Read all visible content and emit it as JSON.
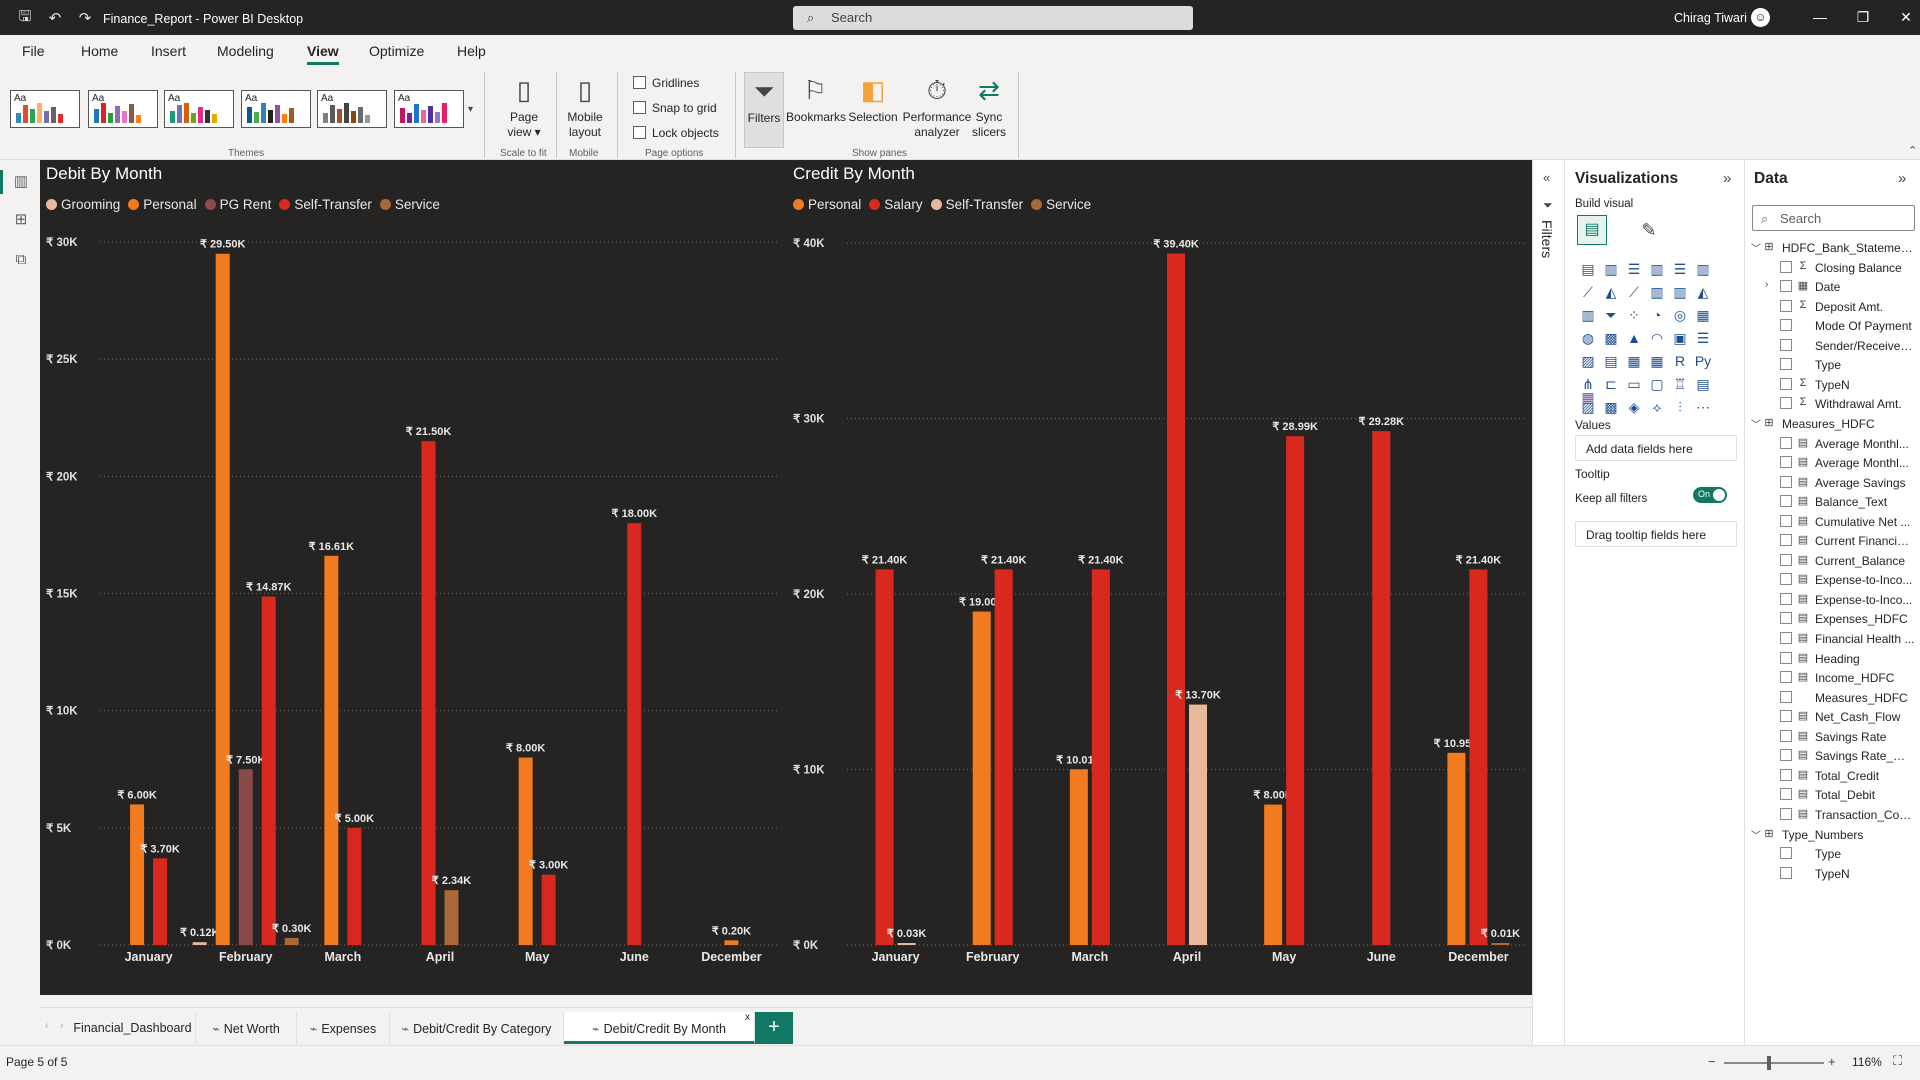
{
  "app": {
    "title": "Finance_Report - Power BI Desktop",
    "search_placeholder": "Search",
    "user_name": "Chirag Tiwari"
  },
  "menu": [
    "File",
    "Home",
    "Insert",
    "Modeling",
    "View",
    "Optimize",
    "Help"
  ],
  "ribbon": {
    "themes_label": "Themes",
    "page_view": "Page view",
    "scale_to_fit": "Scale to fit",
    "mobile_layout": "Mobile layout",
    "mobile": "Mobile",
    "gridlines": "Gridlines",
    "snap_to_grid": "Snap to grid",
    "lock_objects": "Lock objects",
    "page_options": "Page options",
    "filters": "Filters",
    "bookmarks": "Bookmarks",
    "selection": "Selection",
    "performance_analyzer": "Performance analyzer",
    "sync_slicers": "Sync slicers",
    "show_panes": "Show panes"
  },
  "colors": {
    "Grooming": "#e8b89a",
    "Personal": "#f27a1f",
    "PG Rent": "#8a4a4a",
    "Self-Transfer": "#d9291f",
    "Service": "#a8683a",
    "Salary": "#d9291f",
    "Self-Transfer-Credit": "#e8b89a",
    "Service-Credit": "#a8683a",
    "accent": "#117865"
  },
  "chart_data": [
    {
      "type": "bar",
      "title": "Debit By Month",
      "categories": [
        "January",
        "February",
        "March",
        "April",
        "May",
        "June",
        "December"
      ],
      "ylim": [
        0,
        30000
      ],
      "yticks": [
        "₹ 0K",
        "₹ 5K",
        "₹ 10K",
        "₹ 15K",
        "₹ 20K",
        "₹ 25K",
        "₹ 30K"
      ],
      "legend": "top-left",
      "series": [
        {
          "name": "Grooming",
          "values": [
            null,
            120,
            null,
            null,
            null,
            null,
            null
          ],
          "labels": [
            "",
            "₹ 0.12K",
            "",
            "",
            "",
            "",
            ""
          ]
        },
        {
          "name": "Personal",
          "values": [
            6000,
            29500,
            16610,
            null,
            8000,
            null,
            200
          ],
          "labels": [
            "₹ 6.00K",
            "₹ 29.50K",
            "₹ 16.61K",
            "",
            "₹ 8.00K",
            "",
            "₹ 0.20K"
          ]
        },
        {
          "name": "PG Rent",
          "values": [
            null,
            7500,
            null,
            null,
            null,
            null,
            null
          ],
          "labels": [
            "",
            "₹ 7.50K",
            "",
            "",
            "",
            "",
            ""
          ]
        },
        {
          "name": "Self-Transfer",
          "values": [
            3700,
            14870,
            5000,
            21500,
            3000,
            18000,
            null
          ],
          "labels": [
            "₹ 3.70K",
            "₹ 14.87K",
            "₹ 5.00K",
            "₹ 21.50K",
            "₹ 3.00K",
            "₹ 18.00K",
            ""
          ]
        },
        {
          "name": "Service",
          "values": [
            null,
            300,
            null,
            2340,
            null,
            null,
            null
          ],
          "labels": [
            "",
            "₹ 0.30K",
            "",
            "₹ 2.34K",
            "",
            "",
            ""
          ]
        }
      ]
    },
    {
      "type": "bar",
      "title": "Credit By Month",
      "categories": [
        "January",
        "February",
        "March",
        "April",
        "May",
        "June",
        "December"
      ],
      "ylim": [
        0,
        40000
      ],
      "yticks": [
        "₹ 0K",
        "₹ 10K",
        "₹ 20K",
        "₹ 30K",
        "₹ 40K"
      ],
      "legend": "top-left",
      "series": [
        {
          "name": "Personal",
          "values": [
            null,
            19000,
            10010,
            null,
            8000,
            null,
            10950
          ],
          "labels": [
            "",
            "₹ 19.00K",
            "₹ 10.01K",
            "",
            "₹ 8.00K",
            "",
            "₹ 10.95K"
          ]
        },
        {
          "name": "Salary",
          "values": [
            21400,
            21400,
            21400,
            39400,
            28990,
            29280,
            21400
          ],
          "labels": [
            "₹ 21.40K",
            "₹ 21.40K",
            "₹ 21.40K",
            "₹ 39.40K",
            "₹ 28.99K",
            "₹ 29.28K",
            "₹ 21.40K"
          ]
        },
        {
          "name": "Self-Transfer",
          "values": [
            30,
            null,
            null,
            13700,
            null,
            null,
            null
          ],
          "labels": [
            "₹ 0.03K",
            "",
            "",
            "₹ 13.70K",
            "",
            "",
            ""
          ]
        },
        {
          "name": "Service",
          "values": [
            null,
            null,
            null,
            null,
            null,
            null,
            10
          ],
          "labels": [
            "",
            "",
            "",
            "",
            "",
            "",
            "₹ 0.01K"
          ]
        }
      ]
    }
  ],
  "filters_pane": {
    "label": "Filters"
  },
  "viz_pane": {
    "title": "Visualizations",
    "build_visual": "Build visual",
    "values": "Values",
    "values_placeholder": "Add data fields here",
    "tooltip": "Tooltip",
    "keep_all_filters": "Keep all filters",
    "toggle_state": "On",
    "tooltip_placeholder": "Drag tooltip fields here"
  },
  "data_pane": {
    "title": "Data",
    "search_placeholder": "Search",
    "items": [
      {
        "kind": "table",
        "text": "HDFC_Bank_Statement ..."
      },
      {
        "kind": "field",
        "icon": "Σ",
        "text": "Closing Balance"
      },
      {
        "kind": "field",
        "icon": "▦",
        "text": "Date",
        "expand": true
      },
      {
        "kind": "field",
        "icon": "Σ",
        "text": "Deposit Amt."
      },
      {
        "kind": "field",
        "icon": "",
        "text": "Mode Of Payment"
      },
      {
        "kind": "field",
        "icon": "",
        "text": "Sender/Receiver ..."
      },
      {
        "kind": "field",
        "icon": "",
        "text": "Type"
      },
      {
        "kind": "field",
        "icon": "Σ",
        "text": "TypeN"
      },
      {
        "kind": "field",
        "icon": "Σ",
        "text": "Withdrawal Amt."
      },
      {
        "kind": "table",
        "text": "Measures_HDFC"
      },
      {
        "kind": "field",
        "icon": "▤",
        "text": "Average Monthl..."
      },
      {
        "kind": "field",
        "icon": "▤",
        "text": "Average Monthl..."
      },
      {
        "kind": "field",
        "icon": "▤",
        "text": "Average Savings"
      },
      {
        "kind": "field",
        "icon": "▤",
        "text": "Balance_Text"
      },
      {
        "kind": "field",
        "icon": "▤",
        "text": "Cumulative Net ..."
      },
      {
        "kind": "field",
        "icon": "▤",
        "text": "Current Financial..."
      },
      {
        "kind": "field",
        "icon": "▤",
        "text": "Current_Balance"
      },
      {
        "kind": "field",
        "icon": "▤",
        "text": "Expense-to-Inco..."
      },
      {
        "kind": "field",
        "icon": "▤",
        "text": "Expense-to-Inco..."
      },
      {
        "kind": "field",
        "icon": "▤",
        "text": "Expenses_HDFC"
      },
      {
        "kind": "field",
        "icon": "▤",
        "text": "Financial Health ..."
      },
      {
        "kind": "field",
        "icon": "▤",
        "text": "Heading"
      },
      {
        "kind": "field",
        "icon": "▤",
        "text": "Income_HDFC"
      },
      {
        "kind": "field",
        "icon": "",
        "text": "Measures_HDFC"
      },
      {
        "kind": "field",
        "icon": "▤",
        "text": "Net_Cash_Flow"
      },
      {
        "kind": "field",
        "icon": "▤",
        "text": "Savings Rate"
      },
      {
        "kind": "field",
        "icon": "▤",
        "text": "Savings Rate_Mo..."
      },
      {
        "kind": "field",
        "icon": "▤",
        "text": "Total_Credit"
      },
      {
        "kind": "field",
        "icon": "▤",
        "text": "Total_Debit"
      },
      {
        "kind": "field",
        "icon": "▤",
        "text": "Transaction_Count"
      },
      {
        "kind": "table",
        "text": "Type_Numbers"
      },
      {
        "kind": "field",
        "icon": "",
        "text": "Type"
      },
      {
        "kind": "field",
        "icon": "",
        "text": "TypeN"
      }
    ]
  },
  "tabs": [
    {
      "label": "Financial_Dashboard",
      "icon": ""
    },
    {
      "label": "Net Worth",
      "icon": "⌁"
    },
    {
      "label": "Expenses",
      "icon": "⌁"
    },
    {
      "label": "Debit/Credit By Category",
      "icon": "⌁"
    },
    {
      "label": "Debit/Credit By Month",
      "icon": "⌁",
      "active": true
    }
  ],
  "status": {
    "page": "Page 5 of 5",
    "zoom": "116%"
  }
}
